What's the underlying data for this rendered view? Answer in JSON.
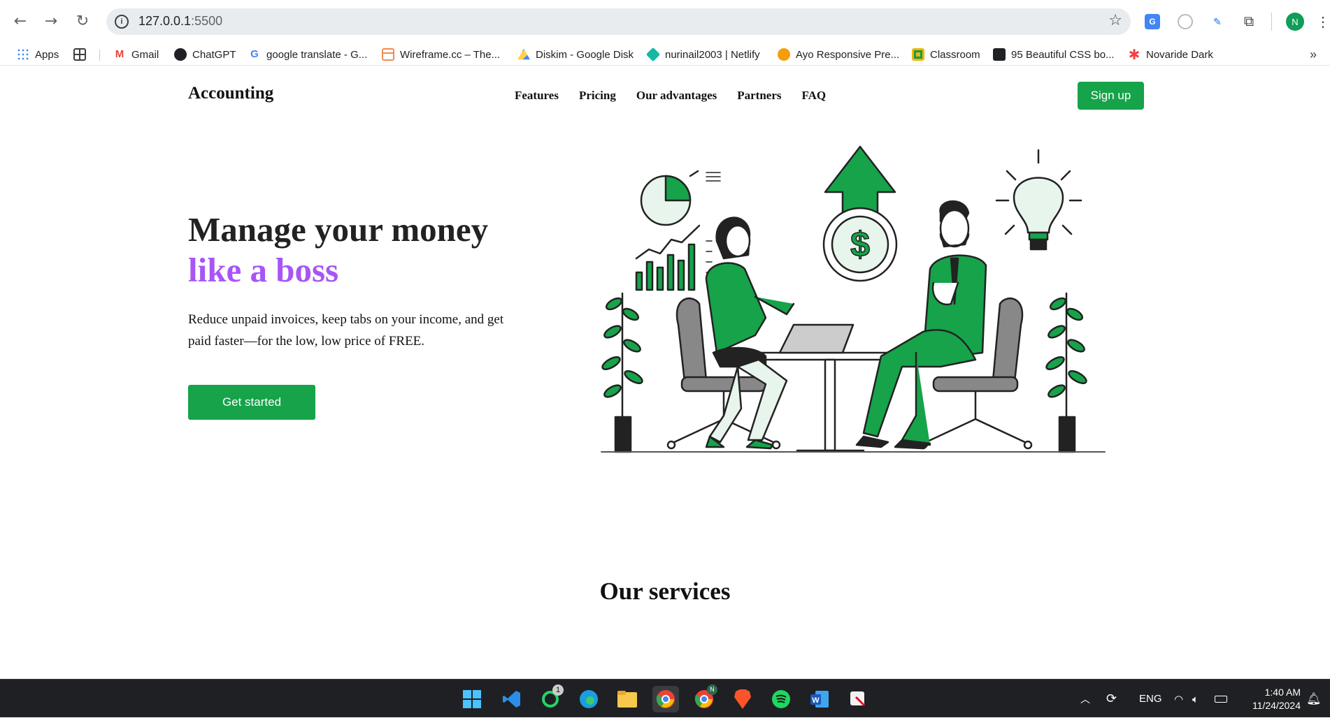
{
  "browser": {
    "url_host": "127.0.0.1",
    "url_port": ":5500",
    "profile_initial": "N",
    "bookmarks": [
      {
        "label": "Apps",
        "icon": "apps-grid-icon",
        "color": "#4285f4"
      },
      {
        "label": "",
        "icon": "tab-groups-icon",
        "color": "#3c4043"
      },
      {
        "label": "Gmail",
        "icon": "gmail-icon",
        "color": "#ea4335"
      },
      {
        "label": "ChatGPT",
        "icon": "chatgpt-icon",
        "color": "#202124"
      },
      {
        "label": "google translate - G...",
        "icon": "google-icon",
        "color": "#4285f4"
      },
      {
        "label": "Wireframe.cc – The...",
        "icon": "wireframe-icon",
        "color": "#f28b54"
      },
      {
        "label": "Diskim - Google Disk",
        "icon": "google-drive-icon",
        "color": "#1fa463"
      },
      {
        "label": "nurinail2003 | Netlify",
        "icon": "netlify-icon",
        "color": "#14b8a6"
      },
      {
        "label": "Ayo Responsive Pre...",
        "icon": "ayo-icon",
        "color": "#f59e0b"
      },
      {
        "label": "Classroom",
        "icon": "classroom-icon",
        "color": "#f4b400"
      },
      {
        "label": "95 Beautiful CSS bo...",
        "icon": "css-icon",
        "color": "#202124"
      },
      {
        "label": "Novaride Dark",
        "icon": "novaride-icon",
        "color": "#ef4444"
      }
    ]
  },
  "site": {
    "brand": "Accounting",
    "nav": [
      "Features",
      "Pricing",
      "Our advantages",
      "Partners",
      "FAQ"
    ],
    "signup_label": "Sign up",
    "hero": {
      "title_line1": "Manage your money",
      "title_line2": "like a boss",
      "description": "Reduce unpaid invoices, keep tabs on your income, and get paid faster—for the low, low price of FREE.",
      "cta_label": "Get started"
    },
    "services_title": "Our services",
    "colors": {
      "accent": "#16a34a",
      "highlight": "#a855f7"
    }
  },
  "taskbar": {
    "whatsapp_badge": "1",
    "chrome_profile_badge": "N",
    "language": "ENG",
    "time": "1:40 AM",
    "date": "11/24/2024"
  }
}
